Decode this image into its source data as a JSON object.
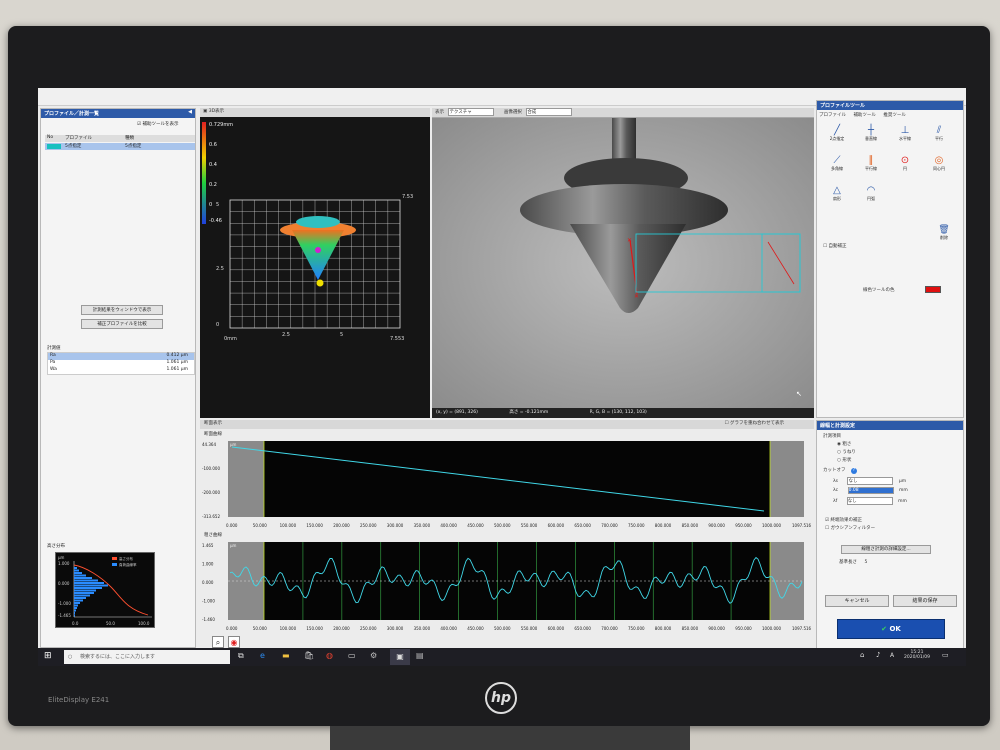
{
  "left": {
    "header": "プロファイル／計測一覧",
    "checkbox": "補助ツールを表示",
    "col_no": "No",
    "col_profile": "プロファイル",
    "col_type": "種類",
    "row_name": "5点指定",
    "row_type": "5点指定",
    "btn1": "計測結果をウィンドウで表示",
    "btn2": "補正プロファイルを比較",
    "meas_label": "計測値",
    "meas_rows": [
      {
        "name": "Ra",
        "val": "0.412 μm"
      },
      {
        "name": "Pa",
        "val": "1.061 μm"
      },
      {
        "name": "Wa",
        "val": "1.061 μm"
      }
    ],
    "hist_label": "高さ分布",
    "hist_legend": [
      "高さ分布",
      "負荷曲線率"
    ],
    "hist_y": [
      "1.000",
      "0.000",
      "-1.000",
      "-1.465"
    ],
    "hist_x": [
      "0.0",
      "50.0",
      "100.0"
    ],
    "hist_unit": "μm"
  },
  "view3d": {
    "title": "3D表示",
    "scale_max": "0.729mm",
    "scale_ticks": [
      "0.6",
      "0.4",
      "0.2",
      "0"
    ],
    "scale_min": "-0.46",
    "y_ticks": [
      "5",
      "2.5",
      "0"
    ],
    "x_ticks": [
      "0mm",
      "2.5",
      "5",
      "7.553"
    ],
    "top_val": "7.53"
  },
  "camera": {
    "tb1": "表示",
    "tb2": "テクスチャ",
    "tb3": "画像選択",
    "tb4": "合成",
    "coords": "(x, y) = (891, 326)",
    "height": "高さ = -0.121mm",
    "rgb": "R, G, B = (130, 112, 103)"
  },
  "profile": {
    "tab": "断面表示",
    "checkbox": "グラフを重ね合わせて表示",
    "upper_title": "断面曲線",
    "upper_unit": "μm",
    "upper_y": [
      "44.364",
      "-100.000",
      "-200.000",
      "-313.652"
    ],
    "x_ticks": [
      "0.000",
      "50.000",
      "100.000",
      "150.000",
      "200.000",
      "250.000",
      "300.000",
      "350.000",
      "400.000",
      "450.000",
      "500.000",
      "550.000",
      "600.000",
      "650.000",
      "700.000",
      "750.000",
      "800.000",
      "850.000",
      "900.000",
      "950.000",
      "1000.000"
    ],
    "x_end": "1097.516",
    "lower_title": "粗さ曲線",
    "lower_unit": "μm",
    "lower_y": [
      "1.465",
      "1.000",
      "0.000",
      "-1.000",
      "-1.460"
    ],
    "x_end_lower": "1097.516"
  },
  "tools": {
    "title": "プロファイルツール",
    "tabs": [
      "プロファイル",
      "補助ツール",
      "推奨ツール"
    ],
    "items": [
      "2点指定",
      "垂直線",
      "水平線",
      "平行",
      "多角線",
      "平行線",
      "円",
      "同心円",
      "扇形",
      "円弧"
    ],
    "delete": "削除",
    "check": "自動補正",
    "color_label": "線色ツールの色",
    "color": "#e01010"
  },
  "settings": {
    "title": "線幅と計測設定",
    "group1": "計測項目",
    "radios": [
      "粗さ",
      "うねり",
      "形状"
    ],
    "group2": "カットオフ",
    "fields": [
      {
        "label": "λs",
        "value": "なし",
        "unit": "μm"
      },
      {
        "label": "λc",
        "value": "0.08",
        "unit": "mm"
      },
      {
        "label": "λf",
        "value": "なし",
        "unit": "mm"
      }
    ],
    "check1": "終端効果の補正",
    "check2": "ガウシアンフィルター",
    "btn_detail": "線粗さ計測の詳細設定...",
    "size_label": "基準長さ",
    "size_val": "5",
    "cancel": "キャンセル",
    "save": "結果の保存",
    "ok": "OK"
  },
  "taskbar": {
    "search": "検索するには、ここに入力します",
    "time": "15:21",
    "date": "2020/01/09",
    "lang": "A"
  },
  "monitor": {
    "model": "EliteDisplay E241",
    "brand": "hp"
  }
}
